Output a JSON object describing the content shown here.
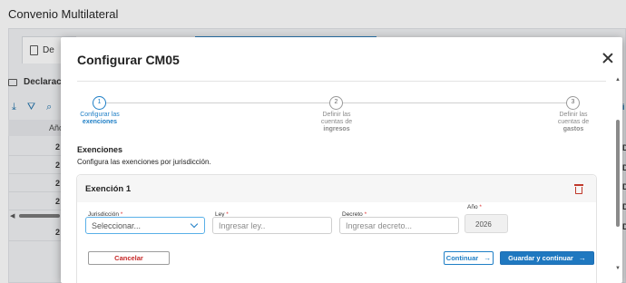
{
  "page": {
    "title": "Convenio Multilateral"
  },
  "background": {
    "tab_label": "De",
    "section_label": "Declaracio",
    "table_header": "Año",
    "rows": [
      "2",
      "2",
      "2",
      "2",
      "2"
    ],
    "right_column": [
      "D",
      "D",
      "D",
      "D",
      "D"
    ]
  },
  "modal": {
    "title": "Configurar CM05",
    "steps": [
      {
        "number": "1",
        "line1": "Configurar las",
        "line2": "exenciones",
        "active": true
      },
      {
        "number": "2",
        "line1": "Definir las",
        "line2": "cuentas de",
        "line3": "ingresos",
        "active": false
      },
      {
        "number": "3",
        "line1": "Definir las",
        "line2": "cuentas de",
        "line3": "gastos",
        "active": false
      }
    ],
    "section_title": "Exenciones",
    "section_subtitle": "Configura las exenciones por jurisdicción.",
    "exemption": {
      "title": "Exención 1",
      "fields": {
        "jurisdiccion": {
          "label": "Jurisdicción",
          "required_mark": "*",
          "value": "Seleccionar..."
        },
        "ley": {
          "label": "Ley",
          "required_mark": "*",
          "placeholder": "Ingresar ley.."
        },
        "decreto": {
          "label": "Decreto",
          "required_mark": "*",
          "placeholder": "Ingresar decreto..."
        },
        "anio": {
          "label": "Año",
          "required_mark": "*",
          "value": "2026"
        }
      }
    },
    "buttons": {
      "cancel": "Cancelar",
      "continue": "Continuar",
      "save_continue": "Guardar y continuar"
    }
  },
  "colors": {
    "accent": "#1f7fc6",
    "danger": "#c62828",
    "primary_button": "#1f78c0"
  }
}
